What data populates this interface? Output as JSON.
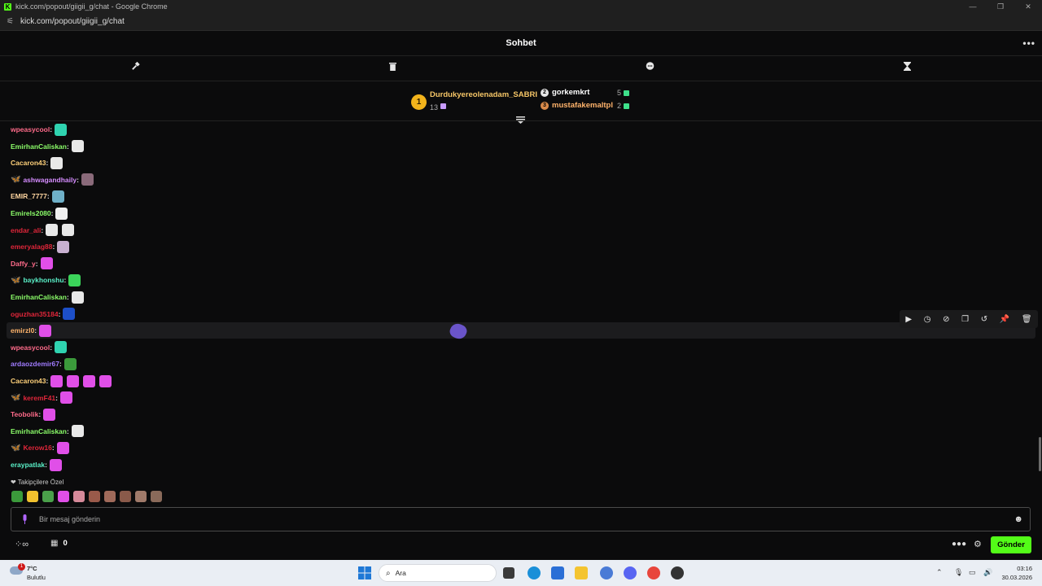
{
  "window": {
    "title": "kick.com/popout/giigii_g/chat - Google Chrome",
    "url": "kick.com/popout/giigii_g/chat",
    "favicon_letter": "K"
  },
  "header": {
    "title": "Sohbet",
    "more_glyph": "•••"
  },
  "leaderboard": {
    "first": {
      "rank": "1",
      "name": "Durdukyereolenadam_SABRI",
      "count": "13"
    },
    "second": {
      "name": "gorkemkrt",
      "count": "5"
    },
    "third": {
      "name": "mustafakemaltpl",
      "count": "2"
    }
  },
  "messages": [
    {
      "user": "wpeasycool",
      "color": "#ff6b8a",
      "badge": false,
      "emotes": [
        "#2fd3b0"
      ]
    },
    {
      "user": "EmirhanCaliskan",
      "color": "#8cff6a",
      "badge": false,
      "emotes": [
        "#e8e8e8"
      ]
    },
    {
      "user": "Cacaron43",
      "color": "#ffd17a",
      "badge": false,
      "emotes": [
        "#e8e8e8"
      ]
    },
    {
      "user": "ashwagandhaily",
      "color": "#d58cff",
      "badge": true,
      "emotes": [
        "#8a6a7a"
      ]
    },
    {
      "user": "EMIR_7777",
      "color": "#ffd6a0",
      "badge": false,
      "emotes": [
        "#6fb0c8"
      ]
    },
    {
      "user": "Emirels2080",
      "color": "#8cff6a",
      "badge": false,
      "emotes": [
        "#f0f0f0"
      ]
    },
    {
      "user": "endar_ali",
      "color": "#e0263a",
      "badge": false,
      "emotes": [
        "#e8e8e8",
        "#e8e8e8"
      ]
    },
    {
      "user": "emeryalag88",
      "color": "#e0263a",
      "badge": false,
      "emotes": [
        "#c8b0d0"
      ]
    },
    {
      "user": "Daffy_y",
      "color": "#ff6b8a",
      "badge": false,
      "emotes": [
        "#e04fe8"
      ]
    },
    {
      "user": "baykhonshu",
      "color": "#5af0c8",
      "badge": true,
      "emotes": [
        "#3bd45a"
      ]
    },
    {
      "user": "EmirhanCaliskan",
      "color": "#8cff6a",
      "badge": false,
      "emotes": [
        "#e8e8e8"
      ]
    },
    {
      "user": "oguzhan35184",
      "color": "#e0263a",
      "badge": false,
      "emotes": [
        "#1d4fc8"
      ]
    },
    {
      "user": "emirzl0",
      "color": "#ffb36b",
      "badge": false,
      "emotes": [
        "#e04fe8"
      ],
      "highlight": true
    },
    {
      "user": "wpeasycool",
      "color": "#ff6b8a",
      "badge": false,
      "emotes": [
        "#2fd3b0"
      ]
    },
    {
      "user": "ardaozdemir67",
      "color": "#a07bff",
      "badge": false,
      "emotes": [
        "#3b9a3b"
      ]
    },
    {
      "user": "Cacaron43",
      "color": "#ffd17a",
      "badge": false,
      "emotes": [
        "#e04fe8",
        "#e04fe8",
        "#e04fe8",
        "#e04fe8"
      ]
    },
    {
      "user": "keremF41",
      "color": "#e0263a",
      "badge": true,
      "emotes": [
        "#e04fe8"
      ]
    },
    {
      "user": "Teobolik",
      "color": "#ff6b8a",
      "badge": false,
      "emotes": [
        "#e04fe8"
      ]
    },
    {
      "user": "EmirhanCaliskan",
      "color": "#8cff6a",
      "badge": false,
      "emotes": [
        "#e8e8e8"
      ]
    },
    {
      "user": "Kerow16",
      "color": "#e0263a",
      "badge": true,
      "badge_color": "#ff9a3b",
      "emotes": [
        "#e04fe8"
      ]
    },
    {
      "user": "eraypatlak",
      "color": "#5af0c8",
      "badge": false,
      "emotes": [
        "#e04fe8"
      ]
    }
  ],
  "followers_only": {
    "label": "Takipçilere Özel",
    "emotes": [
      "#3b9a3b",
      "#f2c12e",
      "#4aa04a",
      "#e04fe8",
      "#d68a9a",
      "#9a5a4a",
      "#a06a5a",
      "#8a5a4a",
      "#a07a6a",
      "#8a6a5a"
    ]
  },
  "input": {
    "placeholder": "Bir mesaj gönderin"
  },
  "footer": {
    "store_count": "0",
    "send_label": "Gönder"
  },
  "taskbar": {
    "weather_temp": "7°C",
    "weather_cond": "Bulutlu",
    "weather_notif": "1",
    "search_placeholder": "Ara",
    "time": "03:16",
    "date": "30.03.2026"
  },
  "colors": {
    "accent": "#53fc18",
    "background": "#0b0b0c"
  }
}
